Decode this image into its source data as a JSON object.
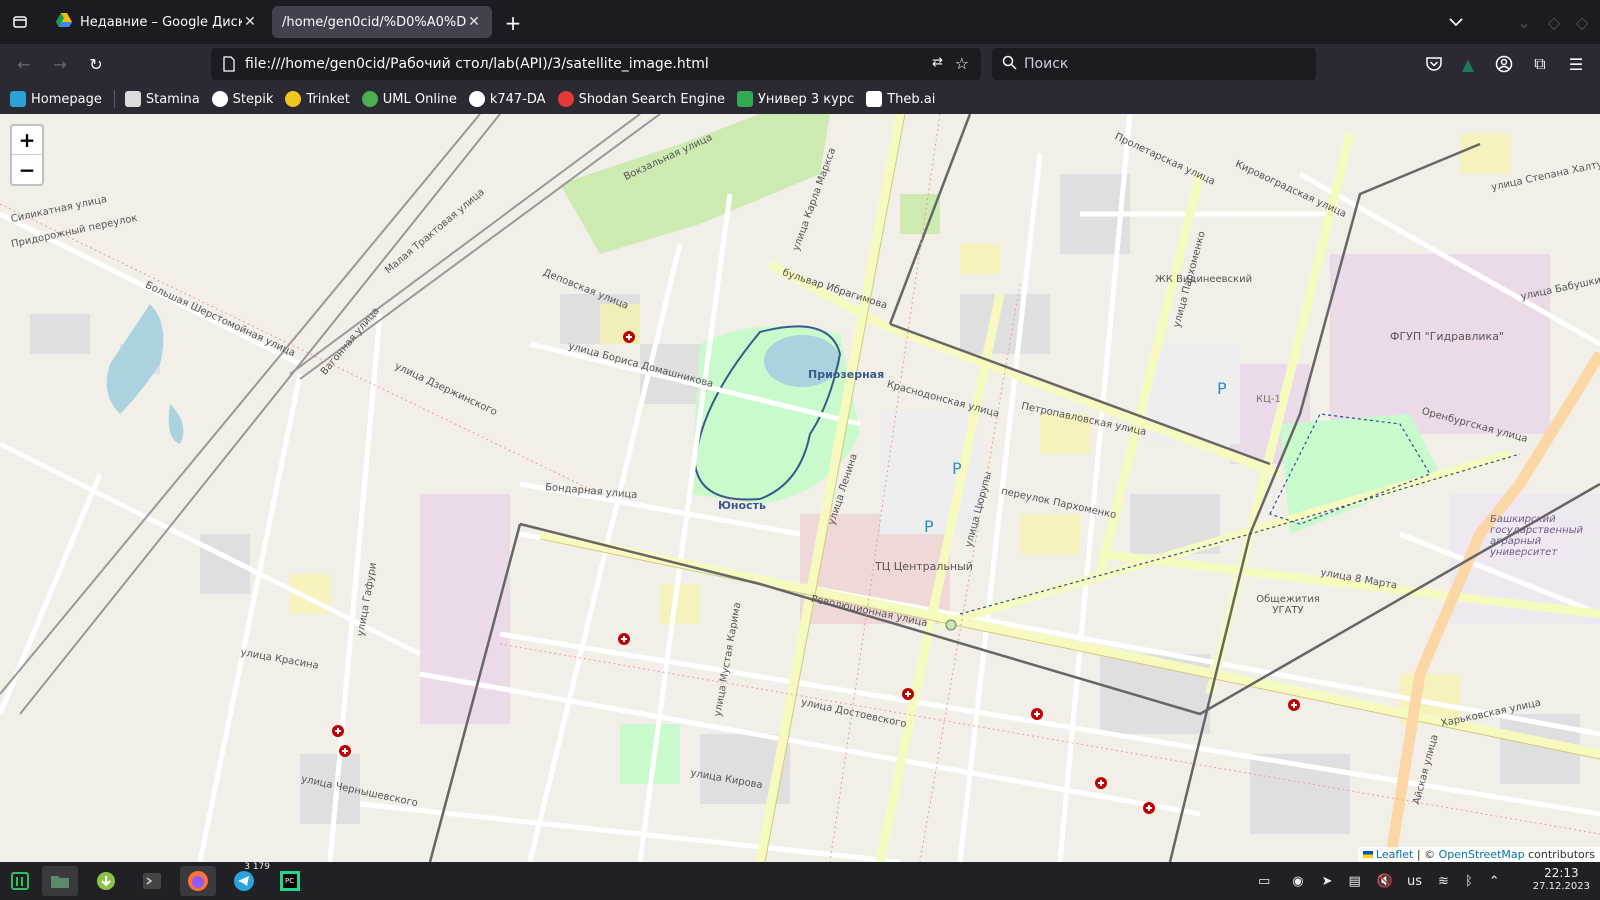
{
  "browser": {
    "tabs": [
      {
        "label": "Недавние – Google Диск"
      },
      {
        "label": "/home/gen0cid/%D0%A0%D0"
      }
    ],
    "url": "file:///home/gen0cid/Рабочий стол/lab(API)/3/satellite_image.html",
    "search_placeholder": "Поиск",
    "bookmarks": [
      {
        "label": "Homepage",
        "color": "#2aa2d6"
      },
      {
        "label": "Stamina",
        "color": "#dcdcdc"
      },
      {
        "label": "Stepik",
        "color": "#ffffff"
      },
      {
        "label": "Trinket",
        "color": "#f2c61f"
      },
      {
        "label": "UML Online",
        "color": "#4caf50"
      },
      {
        "label": "k747-DA",
        "color": "#ffffff"
      },
      {
        "label": "Shodan Search Engine",
        "color": "#e53935"
      },
      {
        "label": "Универ 3 курс",
        "color": "#34a853"
      },
      {
        "label": "Theb.ai",
        "color": "#ffffff"
      }
    ]
  },
  "map": {
    "zoom_in": "+",
    "zoom_out": "−",
    "attribution": {
      "leaflet": "Leaflet",
      "sep": " | © ",
      "osm": "OpenStreetMap",
      "rest": " contributors"
    },
    "labels": [
      {
        "text": "Вокзальная улица"
      },
      {
        "text": "Силикатная улица"
      },
      {
        "text": "Придорожный переулок"
      },
      {
        "text": "Большая Шерстомойная улица"
      },
      {
        "text": "Вагонная улица"
      },
      {
        "text": "Малая Трактовая улица"
      },
      {
        "text": "улица Карла Маркса"
      },
      {
        "text": "бульвар Ибрагимова"
      },
      {
        "text": "Приозерная"
      },
      {
        "text": "Юность"
      },
      {
        "text": "улица Ленина"
      },
      {
        "text": "Революционная улица"
      },
      {
        "text": "улица Достоевского"
      },
      {
        "text": "улица Цюрупы"
      },
      {
        "text": "улица Пархоменко"
      },
      {
        "text": "ЖК Видинеевский"
      },
      {
        "text": "ФГУП \"Гидравлика\""
      },
      {
        "text": "КЦ-1"
      },
      {
        "text": "Оренбургская улица"
      },
      {
        "text": "улица 8 Марта"
      },
      {
        "text": "Общежития УГАТУ"
      },
      {
        "text": "Башкирский государственный аграрный университет"
      },
      {
        "text": "ТЦ Центральный"
      },
      {
        "text": "улица Красина"
      },
      {
        "text": "улица Чернышевского"
      },
      {
        "text": "улица Кирова"
      },
      {
        "text": "Айская улица"
      },
      {
        "text": "улица Бориса Домашникова"
      },
      {
        "text": "улица Дзержинского"
      },
      {
        "text": "Петропавловская улица"
      },
      {
        "text": "Краснодонская улица"
      },
      {
        "text": "Кировоградская улица"
      },
      {
        "text": "Пролетарская улица"
      },
      {
        "text": "Харьковская улица"
      },
      {
        "text": "Деповская улица"
      },
      {
        "text": "Бондарная улица"
      },
      {
        "text": "улица Гафури"
      },
      {
        "text": "улица Мустая Карима"
      },
      {
        "text": "переулок Пархоменко"
      },
      {
        "text": "улица Степана Халтурина"
      },
      {
        "text": "улица Бабушкина"
      }
    ]
  },
  "taskbar": {
    "badge": "3 179",
    "lang": "us",
    "time": "22:13",
    "date": "27.12.2023"
  }
}
